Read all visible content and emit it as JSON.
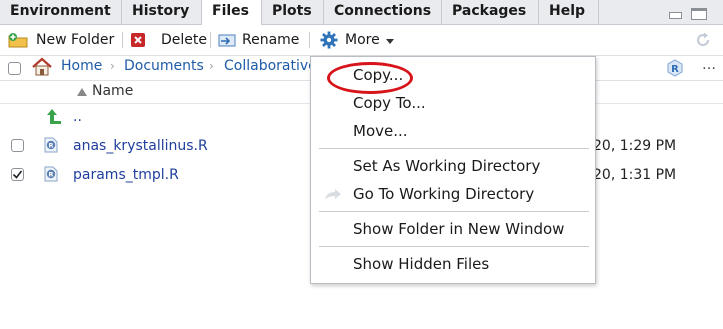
{
  "tabs": [
    {
      "label": "Environment"
    },
    {
      "label": "History"
    },
    {
      "label": "Files"
    },
    {
      "label": "Plots"
    },
    {
      "label": "Connections"
    },
    {
      "label": "Packages"
    },
    {
      "label": "Help"
    }
  ],
  "toolbar": {
    "new_folder": "New Folder",
    "delete": "Delete",
    "rename": "Rename",
    "more": "More"
  },
  "breadcrumb": {
    "home": "Home",
    "documents": "Documents",
    "collab": "Collaborative"
  },
  "columns": {
    "name": "Name"
  },
  "files": {
    "parent": "..",
    "rows": [
      {
        "name": "anas_krystallinus.R",
        "modified": "20, 1:29 PM",
        "checked": false
      },
      {
        "name": "params_tmpl.R",
        "modified": "20, 1:31 PM",
        "checked": true
      }
    ]
  },
  "menu": {
    "items": [
      {
        "label": "Copy...",
        "highlighted": true
      },
      {
        "label": "Copy To..."
      },
      {
        "label": "Move..."
      },
      {
        "label": "Set As Working Directory"
      },
      {
        "label": "Go To Working Directory"
      },
      {
        "label": "Show Folder in New Window"
      },
      {
        "label": "Show Hidden Files"
      }
    ]
  },
  "colors": {
    "link": "#1f5ba8",
    "highlight_ring": "#d7141a",
    "tab_bg": "#e9ebee"
  }
}
